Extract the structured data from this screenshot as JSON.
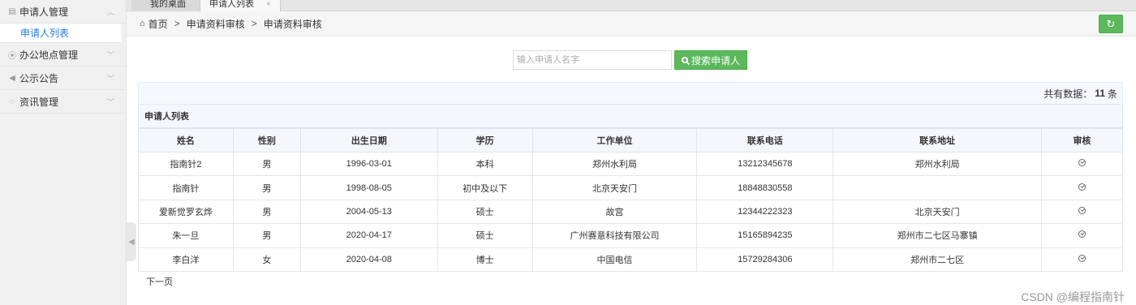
{
  "sidebar": {
    "items": [
      {
        "label": "申请人管理",
        "icon": "list-icon"
      },
      {
        "label": "办公地点管理",
        "icon": "location-icon"
      },
      {
        "label": "公示公告",
        "icon": "megaphone-icon"
      },
      {
        "label": "资讯管理",
        "icon": "chat-icon"
      }
    ],
    "sub_item": "申请人列表"
  },
  "tabs": {
    "home": "我的桌面",
    "active": "申请人列表",
    "close": "×"
  },
  "breadcrumb": {
    "home": "首页",
    "level1": "申请资料审核",
    "level2": "申请资料审核",
    "separator": ">"
  },
  "search": {
    "placeholder": "输入申请人名字",
    "button_label": "搜索申请人"
  },
  "count": {
    "prefix": "共有数据：",
    "value": "11",
    "suffix": "条"
  },
  "table": {
    "title": "申请人列表",
    "columns": [
      "姓名",
      "性别",
      "出生日期",
      "学历",
      "工作单位",
      "联系电话",
      "联系地址",
      "审核"
    ],
    "rows": [
      [
        "指南针2",
        "男",
        "1996-03-01",
        "本科",
        "郑州水利局",
        "13212345678",
        "郑州水利局"
      ],
      [
        "指南针",
        "男",
        "1998-08-05",
        "初中及以下",
        "北京天安门",
        "18848830558",
        ""
      ],
      [
        "爱新觉罗玄烨",
        "男",
        "2004-05-13",
        "硕士",
        "故宫",
        "12344222323",
        "北京天安门"
      ],
      [
        "朱一旦",
        "男",
        "2020-04-17",
        "硕士",
        "广州赛意科技有限公司",
        "15165894235",
        "郑州市二七区马寨镇"
      ],
      [
        "李白洋",
        "女",
        "2020-04-08",
        "博士",
        "中国电信",
        "15729284306",
        "郑州市二七区"
      ]
    ]
  },
  "pagination": {
    "next": "下一页"
  },
  "watermark": "CSDN @编程指南针",
  "colors": {
    "accent_green": "#5cb85c",
    "link_blue": "#1f7ed8"
  }
}
